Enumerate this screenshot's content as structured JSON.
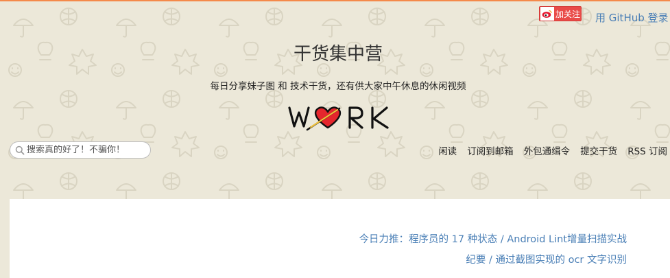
{
  "header": {
    "weibo_follow_label": "加关注",
    "github_login_label": "用 GitHub 登录",
    "site_title": "干货集中营",
    "site_subtitle": "每日分享妹子图 和 技术干货，还有供大家中午休息的休闲视频",
    "logo_text": "WORK"
  },
  "search": {
    "placeholder": "搜索真的好了！不骗你！"
  },
  "nav": {
    "items": [
      {
        "label": "闲读"
      },
      {
        "label": "订阅到邮箱"
      },
      {
        "label": "外包通缉令"
      },
      {
        "label": "提交干货"
      },
      {
        "label": "RSS 订阅"
      }
    ]
  },
  "recommend": {
    "prefix": "今日力推：",
    "separator": " / ",
    "links": [
      "程序员的 17 种状态",
      "Android Lint增量扫描实战",
      "纪要",
      "通过截图实现的 ocr 文字识别"
    ]
  },
  "colors": {
    "background": "#ece8d9",
    "top_strip": "#f4894a",
    "link": "#4a7fb6",
    "weibo_red": "#e94b48",
    "heart_red": "#e5262d"
  }
}
